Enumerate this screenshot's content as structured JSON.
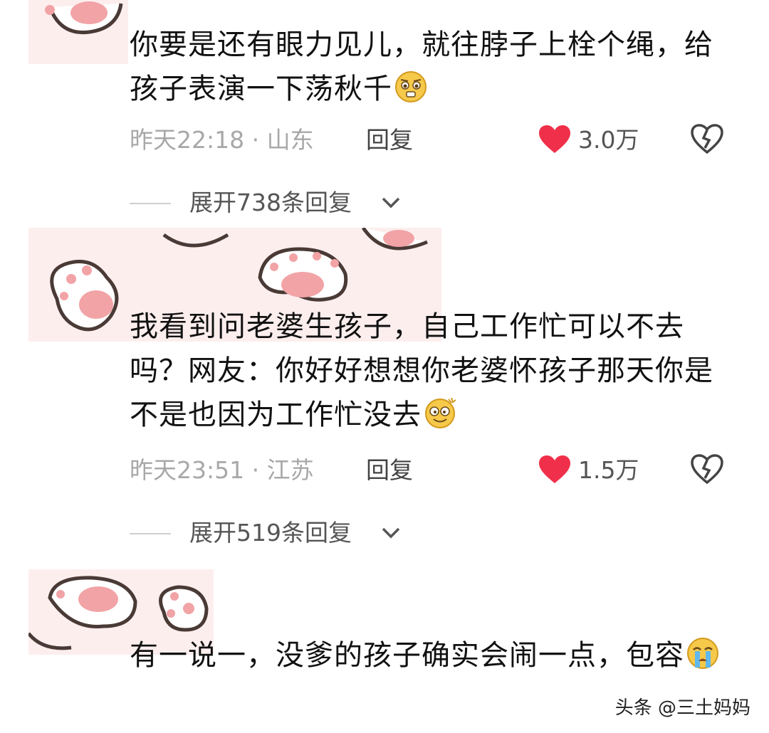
{
  "comments": [
    {
      "text": "你要是还有眼力见儿，就往脖子上栓个绳，给孩子表演一下荡秋千",
      "emoji": "pleading-face",
      "time_location": "昨天22:18 · 山东",
      "reply_label": "回复",
      "likes": "3.0万",
      "expand_label": "展开738条回复"
    },
    {
      "text": "我看到问老婆生孩子，自己工作忙可以不去吗？网友：你好好想想你老婆怀孩子那天你是不是也因为工作忙没去",
      "emoji": "dizzy-smile-face",
      "time_location": "昨天23:51 · 江苏",
      "reply_label": "回复",
      "likes": "1.5万",
      "expand_label": "展开519条回复"
    },
    {
      "text": "有一说一，没爹的孩子确实会闹一点，包容",
      "emoji": "crying-face"
    }
  ],
  "watermark": "头条 @三土妈妈",
  "colors": {
    "heart": "#f0304a",
    "paw_pad": "#f2a3a6",
    "paw_outline": "#4a3a36",
    "decor_bg": "#fdeeee"
  }
}
